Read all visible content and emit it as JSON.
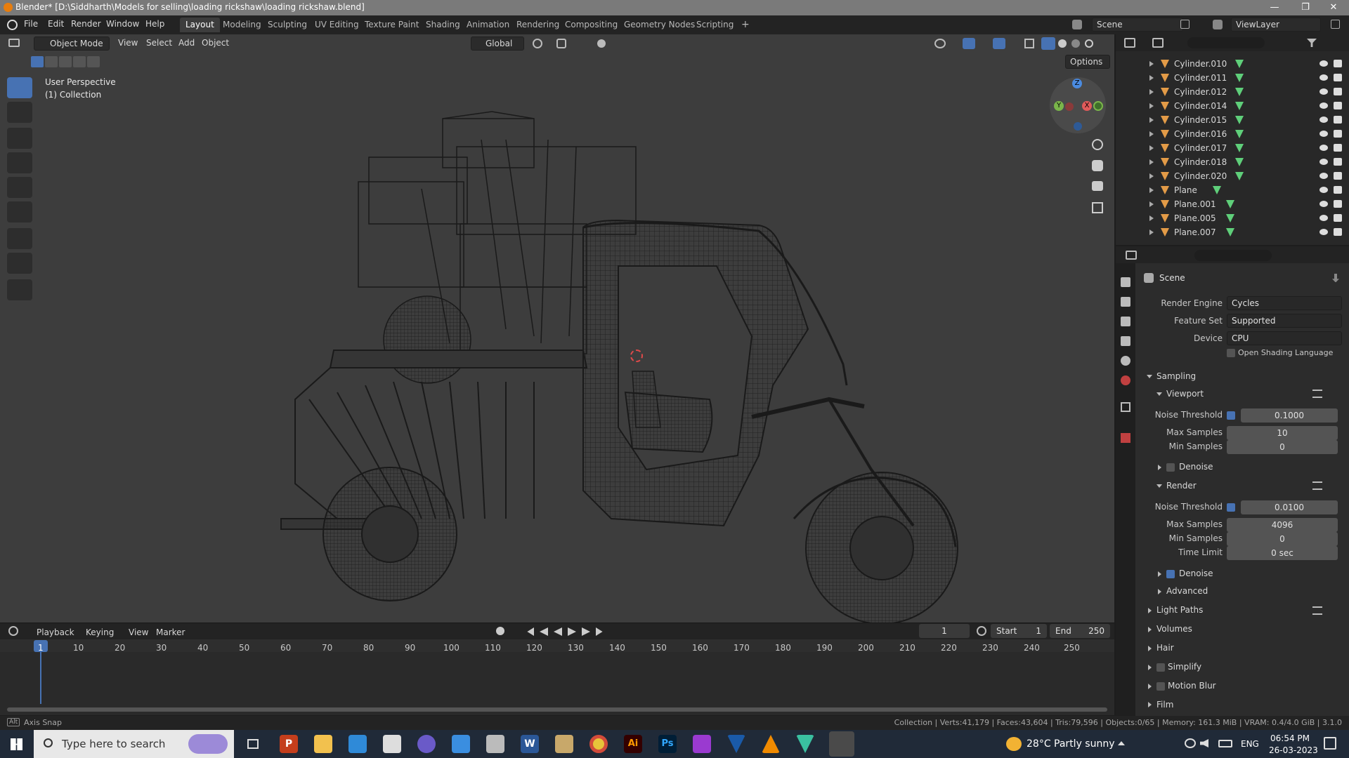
{
  "window": {
    "title": "Blender* [D:\\Siddharth\\Models for selling\\loading rickshaw\\loading rickshaw.blend]",
    "minimize_glyph": "—",
    "maximize_glyph": "❐",
    "close_glyph": "✕"
  },
  "menu": {
    "items": [
      "File",
      "Edit",
      "Render",
      "Window",
      "Help"
    ]
  },
  "workspaces": {
    "tabs": [
      "Layout",
      "Modeling",
      "Sculpting",
      "UV Editing",
      "Texture Paint",
      "Shading",
      "Animation",
      "Rendering",
      "Compositing",
      "Geometry Nodes",
      "Scripting"
    ],
    "active": "Layout",
    "add_glyph": "+"
  },
  "scene_selector": {
    "value": "Scene"
  },
  "viewlayer_selector": {
    "value": "ViewLayer"
  },
  "viewport_header": {
    "mode": "Object Mode",
    "menus": [
      "View",
      "Select",
      "Add",
      "Object"
    ],
    "orientation": "Global",
    "options_label": "Options"
  },
  "viewport_overlay": {
    "perspective": "User Perspective",
    "collection": "(1) Collection"
  },
  "gizmo": {
    "z": "Z",
    "y": "Y",
    "x": "X"
  },
  "outliner": {
    "rows": [
      "Cylinder.010",
      "Cylinder.011",
      "Cylinder.012",
      "Cylinder.014",
      "Cylinder.015",
      "Cylinder.016",
      "Cylinder.017",
      "Cylinder.018",
      "Cylinder.020",
      "Plane",
      "Plane.001",
      "Plane.005",
      "Plane.007"
    ]
  },
  "properties": {
    "context": "Scene",
    "render_engine_label": "Render Engine",
    "render_engine": "Cycles",
    "feature_set_label": "Feature Set",
    "feature_set": "Supported",
    "device_label": "Device",
    "device": "CPU",
    "osl_label": "Open Shading Language",
    "sampling": "Sampling",
    "viewport": "Viewport",
    "noise_threshold_label": "Noise Threshold",
    "vp_noise_threshold": "0.1000",
    "max_samples_label": "Max Samples",
    "vp_max_samples": "10",
    "min_samples_label": "Min Samples",
    "vp_min_samples": "0",
    "denoise_label": "Denoise",
    "render": "Render",
    "r_noise_threshold": "0.0100",
    "r_max_samples": "4096",
    "r_min_samples": "0",
    "time_limit_label": "Time Limit",
    "r_time_limit": "0 sec",
    "advanced": "Advanced",
    "light_paths": "Light Paths",
    "volumes": "Volumes",
    "hair": "Hair",
    "simplify": "Simplify",
    "motion_blur": "Motion Blur",
    "film": "Film"
  },
  "timeline": {
    "menus": [
      "Playback",
      "Keying",
      "View",
      "Marker"
    ],
    "current_frame": "1",
    "start_label": "Start",
    "start": "1",
    "end_label": "End",
    "end": "250",
    "ticks": [
      "1",
      "10",
      "20",
      "30",
      "40",
      "50",
      "60",
      "70",
      "80",
      "90",
      "100",
      "110",
      "120",
      "130",
      "140",
      "150",
      "160",
      "170",
      "180",
      "190",
      "200",
      "210",
      "220",
      "230",
      "240",
      "250"
    ]
  },
  "status": {
    "left_key": "Alt",
    "left_text": "Axis Snap",
    "stats": "Collection | Verts:41,179 | Faces:43,604 | Tris:79,596 | Objects:0/65 | Memory: 161.3 MiB | VRAM: 0.4/4.0 GiB | 3.1.0"
  },
  "taskbar": {
    "search_placeholder": "Type here to search",
    "weather": "28°C  Partly sunny",
    "lang": "ENG",
    "time": "06:54 PM",
    "date": "26-03-2023",
    "icon_ps": "Ps",
    "icon_ai": "Ai",
    "icon_w": "W",
    "icon_p": "P"
  },
  "colors": {
    "accent": "#4772b3",
    "object_orange": "#e39b47",
    "mesh_green": "#5fcf7a",
    "gizmo_red": "#e05a5a",
    "gizmo_green": "#7ab54a",
    "gizmo_blue": "#4b8be0"
  }
}
